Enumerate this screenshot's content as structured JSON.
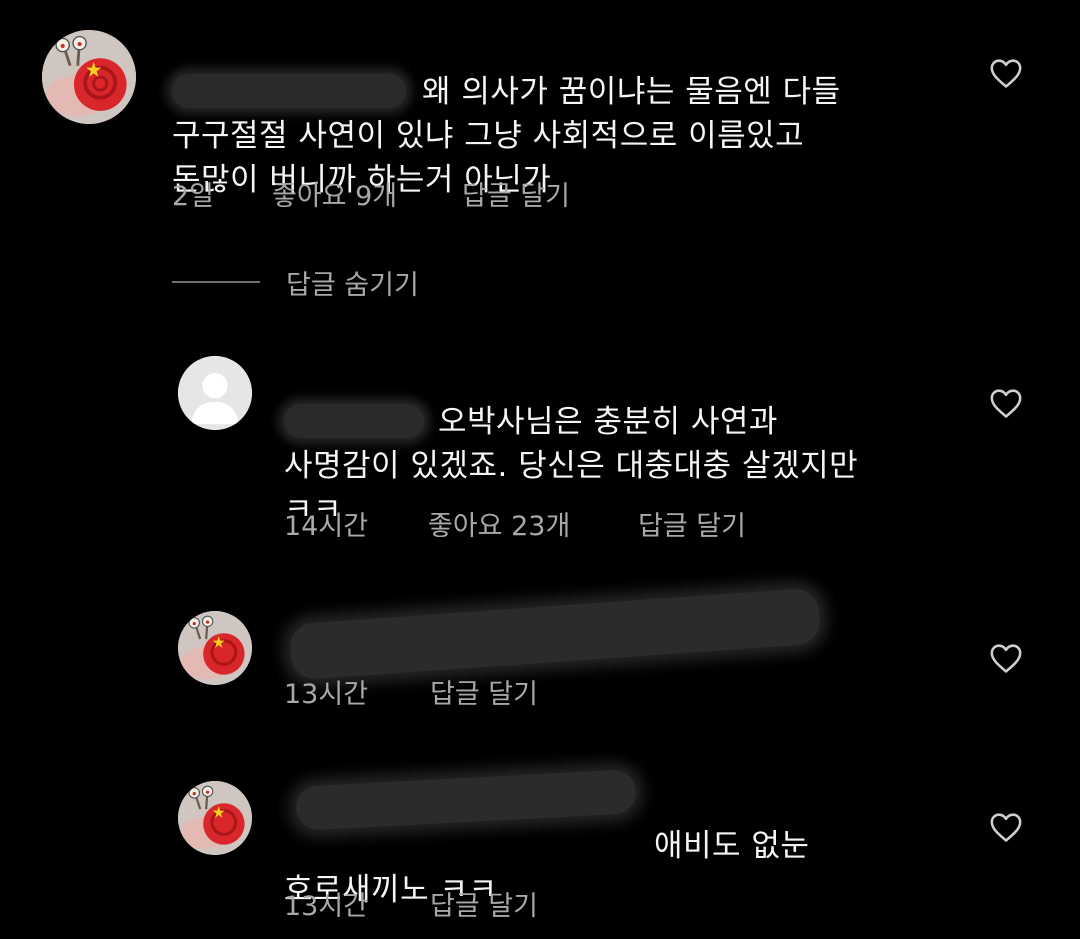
{
  "comments": [
    {
      "text": "왜 의사가 꿈이냐는 물음엔 다들\n구구절절 사연이 있냐 그냥 사회적으로 이름있고\n돈많이 버니까 하는거 아닌가",
      "time": "2일",
      "likes": "좋아요 9개",
      "reply_label": "답글 달기"
    },
    {
      "text": "오박사님은 충분히 사연과\n사명감이 있겠죠. 당신은 대충대충 살겠지만\nㅋㅋ",
      "time": "14시간",
      "likes": "좋아요 23개",
      "reply_label": "답글 달기"
    },
    {
      "text": "",
      "time": "13시간",
      "reply_label": "답글 달기"
    },
    {
      "text": "애비도 없눈\n호로새끼노 ㅋㅋ",
      "time": "13시간",
      "reply_label": "답글 달기"
    }
  ],
  "hide_replies_label": "답글 숨기기",
  "icons": {
    "like": "heart-outline-icon",
    "avatar_default": "default-user-icon",
    "avatar_snail": "snail-avatar-icon"
  },
  "colors": {
    "background": "#000000",
    "text": "#f5f5f5",
    "meta": "#a8a8a8"
  }
}
